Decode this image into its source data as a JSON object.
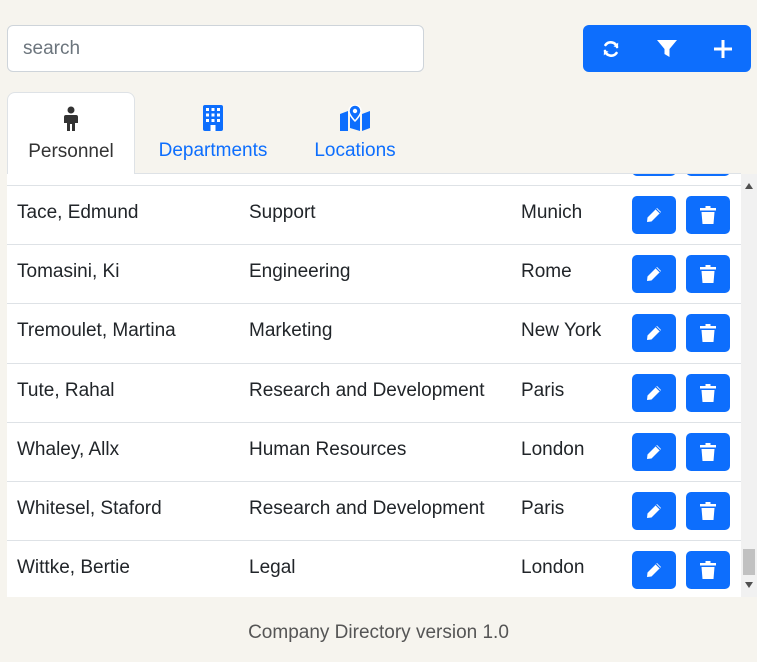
{
  "search": {
    "placeholder": "search"
  },
  "toolbar": {
    "refresh_icon": "refresh-icon",
    "filter_icon": "filter-icon",
    "add_icon": "plus-icon"
  },
  "tabs": [
    {
      "label": "Personnel",
      "icon": "person-icon",
      "active": true
    },
    {
      "label": "Departments",
      "icon": "building-icon",
      "active": false
    },
    {
      "label": "Locations",
      "icon": "map-icon",
      "active": false
    }
  ],
  "rows": [
    {
      "name": "Tace, Edmund",
      "department": "Support",
      "location": "Munich"
    },
    {
      "name": "Tomasini, Ki",
      "department": "Engineering",
      "location": "Rome"
    },
    {
      "name": "Tremoulet, Martina",
      "department": "Marketing",
      "location": "New York"
    },
    {
      "name": "Tute, Rahal",
      "department": "Research and Development",
      "location": "Paris"
    },
    {
      "name": "Whaley, Allx",
      "department": "Human Resources",
      "location": "London"
    },
    {
      "name": "Whitesel, Staford",
      "department": "Research and Development",
      "location": "Paris"
    },
    {
      "name": "Wittke, Bertie",
      "department": "Legal",
      "location": "London"
    }
  ],
  "footer": {
    "text": "Company Directory version 1.0"
  },
  "colors": {
    "accent": "#0d6efd",
    "background": "#f6f4ee"
  }
}
